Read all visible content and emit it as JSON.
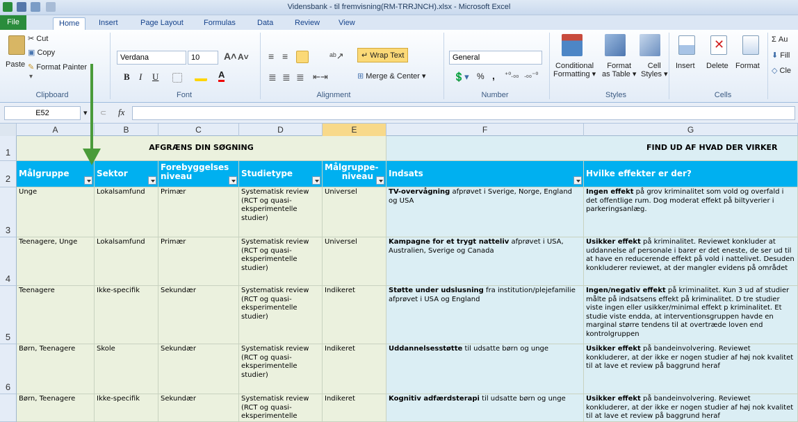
{
  "window": {
    "title": "Vidensbank - til fremvisning(RM-TRRJNCH).xlsx - Microsoft Excel"
  },
  "tabs": [
    "File",
    "Home",
    "Insert",
    "Page Layout",
    "Formulas",
    "Data",
    "Review",
    "View"
  ],
  "ribbon": {
    "clipboard": {
      "paste": "Paste",
      "cut": "Cut",
      "copy": "Copy",
      "format_painter": "Format Painter",
      "label": "Clipboard"
    },
    "font": {
      "name": "Verdana",
      "size": "10",
      "bold": "B",
      "italic": "I",
      "underline": "U",
      "label": "Font"
    },
    "alignment": {
      "wrap_text": "Wrap Text",
      "merge_center": "Merge & Center",
      "label": "Alignment"
    },
    "number": {
      "format": "General",
      "percent": "%",
      "comma": ",",
      "label": "Number"
    },
    "styles": {
      "conditional": "Conditional",
      "conditional2": "Formatting",
      "format_table": "Format",
      "format_table2": "as Table",
      "cell_styles": "Cell",
      "cell_styles2": "Styles",
      "label": "Styles"
    },
    "cells": {
      "insert": "Insert",
      "delete": "Delete",
      "format": "Format",
      "label": "Cells"
    },
    "editing": {
      "autosum": "Σ Au",
      "fill": "Fill",
      "clear": "Cle"
    }
  },
  "formula_bar": {
    "name_box": "E52",
    "fx": "fx",
    "value": ""
  },
  "columns": [
    "A",
    "B",
    "C",
    "D",
    "E",
    "F",
    "G"
  ],
  "rows": [
    "1",
    "2",
    "3",
    "4",
    "5",
    "6",
    ""
  ],
  "sections": {
    "left": "AFGRÆNS DIN SØGNING",
    "right": "FIND UD AF HVAD DER VIRKER"
  },
  "headers": [
    "Målgruppe",
    "Sektor",
    "Forebyggelses niveau",
    "Studietype",
    "Målgruppe-niveau",
    "Indsats",
    "Hvilke effekter er der?"
  ],
  "data": [
    {
      "a": "Unge",
      "b": "Lokalsamfund",
      "c": "Primær",
      "d": "Systematisk review (RCT og quasi-eksperimentelle studier)",
      "e": "Universel",
      "f_bold": "TV-overvågning",
      "f_rest": " afprøvet i Sverige, Norge, England og USA",
      "g_bold": "Ingen effekt",
      "g_rest": " på grov kriminalitet som vold og overfald i det offentlige rum. Dog moderat effekt på biltyverier i parkeringsanlæg."
    },
    {
      "a": "Teenagere, Unge",
      "b": "Lokalsamfund",
      "c": "Primær",
      "d": "Systematisk review (RCT og quasi-eksperimentelle studier)",
      "e": "Universel",
      "f_bold": "Kampagne for et trygt natteliv",
      "f_rest": " afprøvet i USA, Australien, Sverige og Canada",
      "g_bold": "Usikker effekt",
      "g_rest": " på kriminalitet. Reviewet konkluder at uddannelse af personale i barer er det eneste, de ser ud til at have en reducerende effekt på vold i nattelivet. Desuden konkluderer reviewet, at der mangler evidens på området"
    },
    {
      "a": "Teenagere",
      "b": "Ikke-specifik",
      "c": "Sekundær",
      "d": "Systematisk review (RCT og quasi-eksperimentelle studier)",
      "e": "Indikeret",
      "f_bold": "Støtte under udslusning",
      "f_rest": " fra institution/plejefamilie afprøvet i USA og England",
      "g_bold": "Ingen/negativ effekt",
      "g_rest": " på kriminalitet. Kun 3 ud af studier målte på indsatsens effekt på kriminalitet. D tre studier viste ingen eller usikker/minimal effekt p kriminalitet. Et studie viste endda, at interventionsgruppen havde en marginal større tendens til at overtræde loven end kontrolgruppen"
    },
    {
      "a": "Børn, Teenagere",
      "b": "Skole",
      "c": "Sekundær",
      "d": "Systematisk review (RCT og quasi-eksperimentelle studier)",
      "e": "Indikeret",
      "f_bold": "Uddannelsesstøtte",
      "f_rest": " til udsatte børn og unge",
      "g_bold": "Usikker effekt",
      "g_rest": " på bandeinvolvering. Reviewet konkluderer, at der ikke er nogen studier af høj nok kvalitet til at lave et review på baggrund heraf"
    },
    {
      "a": "Børn, Teenagere",
      "b": "Ikke-specifik",
      "c": "Sekundær",
      "d": "Systematisk review (RCT og quasi-eksperimentelle",
      "e": "Indikeret",
      "f_bold": "Kognitiv adfærdsterapi",
      "f_rest": " til udsatte børn og unge",
      "g_bold": "Usikker effekt",
      "g_rest": " på bandeinvolvering. Reviewet konkluderer, at der ikke er nogen studier af høj nok kvalitet til at lave et review på baggrund heraf"
    }
  ],
  "colors": {
    "accent": "#00b0f0",
    "green_fill": "#ebf1de",
    "blue_fill": "#dbeef4",
    "arrow": "#4a9b3a"
  }
}
